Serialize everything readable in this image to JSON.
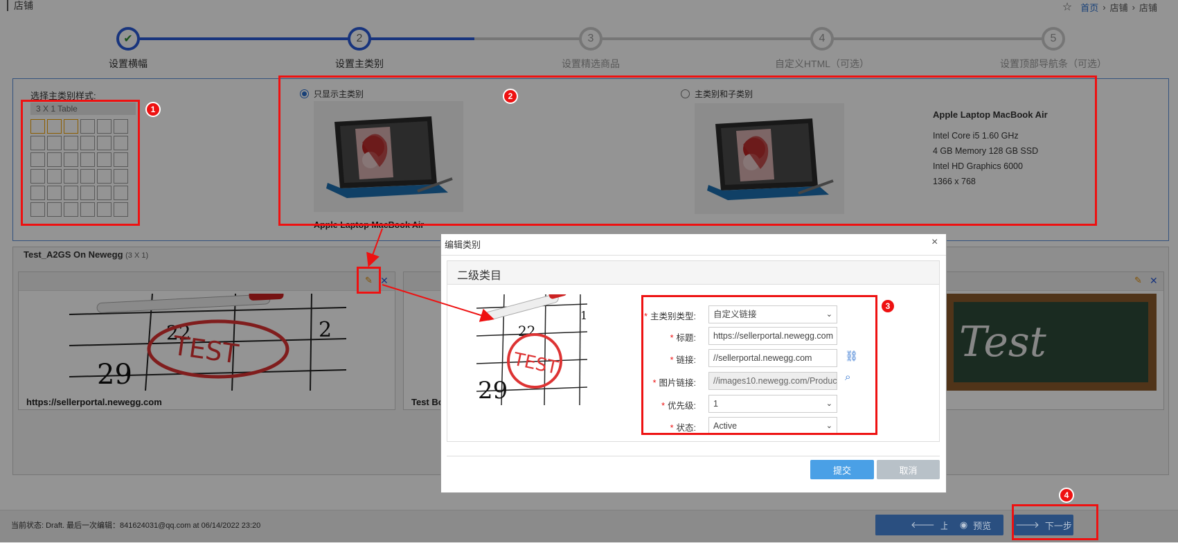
{
  "header": {
    "page_title": "店铺",
    "breadcrumb": [
      "首页",
      "店铺",
      "店铺"
    ]
  },
  "steps": [
    {
      "num": "✔",
      "label": "设置横幅",
      "state": "done"
    },
    {
      "num": "2",
      "label": "设置主类别",
      "state": "active"
    },
    {
      "num": "3",
      "label": "设置精选商品",
      "state": "todo"
    },
    {
      "num": "4",
      "label": "自定义HTML（可选）",
      "state": "todo"
    },
    {
      "num": "5",
      "label": "设置顶部导航条（可选）",
      "state": "todo"
    }
  ],
  "style_picker": {
    "label": "选择主类别样式:",
    "selected": "3 X 1 Table",
    "grid_rows": 6,
    "grid_cols": 6,
    "highlighted_cols": 3
  },
  "display_options": [
    {
      "label": "只显示主类别",
      "checked": true
    },
    {
      "label": "主类别和子类别",
      "checked": false
    }
  ],
  "product": {
    "name": "Apple Laptop MacBook Air",
    "specs": [
      "Intel Core i5 1.60 GHz",
      "4 GB Memory 128 GB SSD",
      "Intel HD Graphics 6000",
      "1366 x 768"
    ]
  },
  "caption_under_preview": "Apple Laptop MacBook Air",
  "store": {
    "name": "Test_A2GS On Newegg",
    "layout": "(3 X 1)",
    "cards": [
      {
        "caption": "https://sellerportal.newegg.com"
      },
      {
        "caption": "Test Bo"
      }
    ]
  },
  "modal": {
    "title": "编辑类别",
    "section_title": "二级类目",
    "fields": [
      {
        "label": "主类别类型:",
        "value": "自定义链接",
        "type": "select"
      },
      {
        "label": "标题:",
        "value": "https://sellerportal.newegg.com",
        "type": "text"
      },
      {
        "label": "链接:",
        "value": "//sellerportal.newegg.com",
        "type": "text"
      },
      {
        "label": "图片链接:",
        "value": "//images10.newegg.com/Produc",
        "type": "readonly"
      },
      {
        "label": "优先级:",
        "value": "1",
        "type": "select"
      },
      {
        "label": "状态:",
        "value": "Active",
        "type": "select"
      }
    ],
    "submit_label": "提交",
    "cancel_label": "取消"
  },
  "badges": [
    "1",
    "2",
    "3",
    "4"
  ],
  "status_bar": {
    "text": "当前状态: Draft. 最后一次编辑：841624031@qq.com at 06/14/2022 23:20",
    "prev_label": "上一步",
    "preview_label": "预览",
    "next_label": "下一步"
  },
  "colors": {
    "accent": "#2a5bd7",
    "annotation": "#ee1111",
    "primary_button": "#4aa0e6"
  }
}
